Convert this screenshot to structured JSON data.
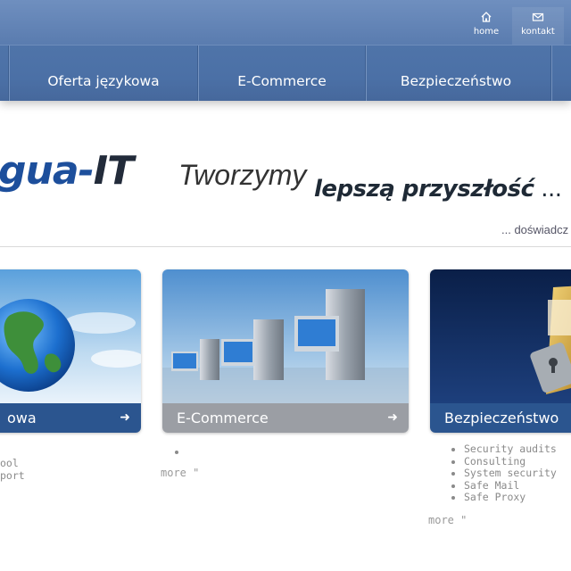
{
  "toplinks": [
    {
      "label": "home",
      "icon": "home-icon"
    },
    {
      "label": "kontakt",
      "icon": "mail-icon"
    }
  ],
  "nav": [
    "Oferta językowa",
    "E-Commerce",
    "Bezpieczeństwo"
  ],
  "slogan": {
    "logo_blue": "gua-",
    "logo_dark": "IT",
    "tworzymy": "Tworzymy",
    "lepsza": "lepszą przyszłość",
    "dots": " ...",
    "sub": "... doświadcz"
  },
  "cards": [
    {
      "label": "owa",
      "fragments": [
        "ool",
        "port"
      ]
    },
    {
      "label": "E-Commerce",
      "more": "more \""
    },
    {
      "label": "Bezpieczeństwo",
      "items": [
        "Security audits",
        "Consulting",
        "System security",
        "Safe Mail",
        "Safe Proxy"
      ],
      "more": "more \""
    }
  ],
  "colors": {
    "nav": "#4b70a6",
    "bar_blue": "#2b558f",
    "bar_grey": "#9b9ea4"
  }
}
